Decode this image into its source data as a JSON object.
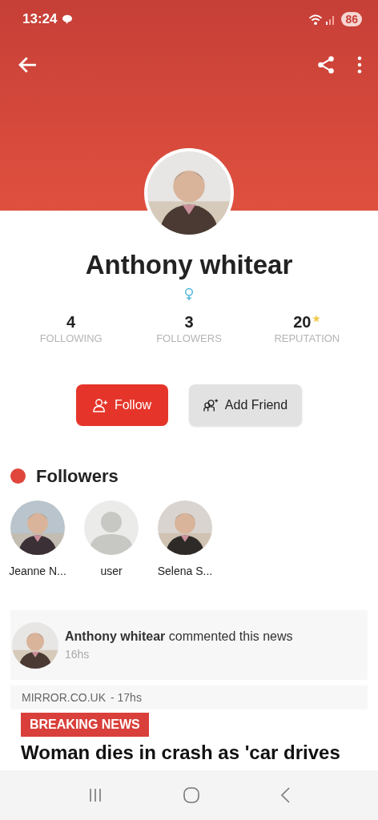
{
  "status_bar": {
    "time": "13:24",
    "battery": "86"
  },
  "profile": {
    "name": "Anthony whitear",
    "stats": [
      {
        "value": "4",
        "label": "FOLLOWING",
        "star": false
      },
      {
        "value": "3",
        "label": "FOLLOWERS",
        "star": false
      },
      {
        "value": "20",
        "label": "REPUTATION",
        "star": true
      }
    ],
    "buttons": [
      {
        "kind": "primary",
        "label": "Follow"
      },
      {
        "kind": "secondary",
        "label": "Add Friend"
      }
    ]
  },
  "followers": {
    "title": "Followers",
    "items": [
      {
        "name": "Jeanne N...",
        "kind": "picture"
      },
      {
        "name": "user",
        "kind": "default"
      },
      {
        "name": "Selena S...",
        "kind": "picture"
      }
    ]
  },
  "activity": {
    "text": "**Anthony whitear** commented this news",
    "time": "16hs"
  },
  "news": {
    "source": "MIRROR.CO.UK",
    "time": "- 17hs",
    "badge": "BREAKING NEWS",
    "headline": "Woman dies in crash as 'car drives"
  }
}
